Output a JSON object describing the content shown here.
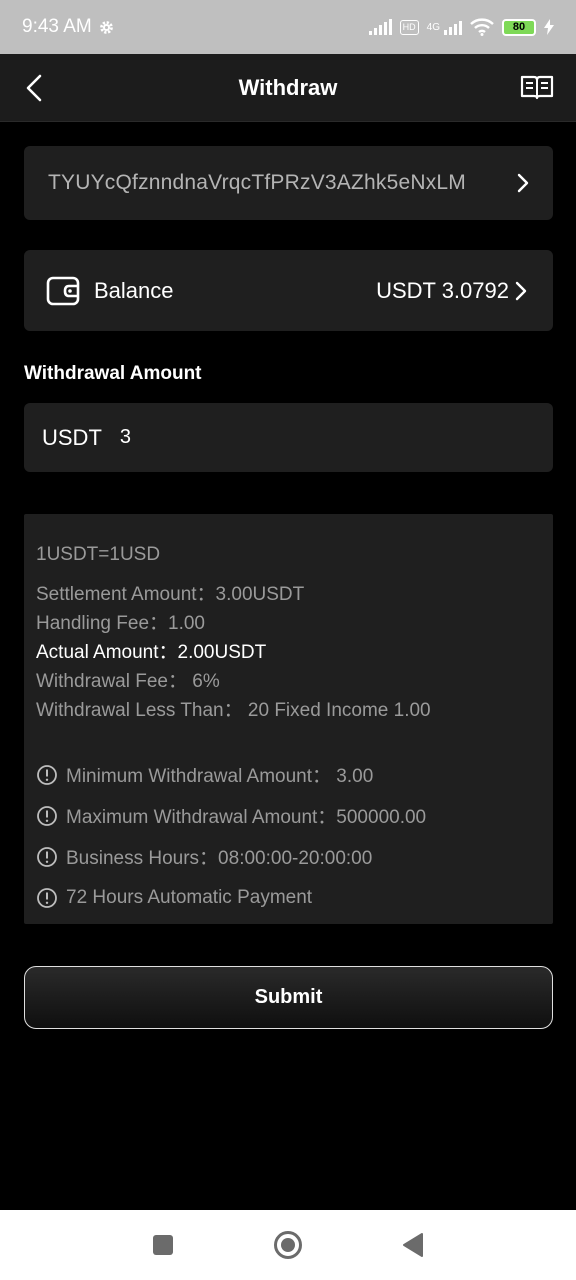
{
  "status_bar": {
    "time": "9:43 AM",
    "network_label": "4G",
    "volte_label": "HD",
    "battery": "80"
  },
  "header": {
    "title": "Withdraw"
  },
  "address": {
    "value": "TYUYcQfznndnaVrqcTfPRzV3AZhk5eNxLM"
  },
  "balance": {
    "label": "Balance",
    "value": "USDT 3.0792"
  },
  "withdrawal": {
    "section_label": "Withdrawal Amount",
    "unit": "USDT",
    "amount": "3"
  },
  "info": {
    "rate": "1USDT=1USD",
    "settlement": "Settlement Amount：3.00USDT",
    "handling_fee": "Handling Fee：1.00",
    "actual_amount": "Actual Amount：2.00USDT",
    "withdrawal_fee": "Withdrawal Fee： 6%",
    "less_than": "Withdrawal Less Than： 20 Fixed Income 1.00",
    "notes": [
      "Minimum Withdrawal Amount： 3.00",
      "Maximum Withdrawal Amount：500000.00",
      "Business Hours：08:00:00-20:00:00",
      "72 Hours Automatic Payment"
    ]
  },
  "submit": {
    "label": "Submit"
  },
  "colors": {
    "background": "#000000",
    "card": "#1f1f1f",
    "muted_text": "#9a9a9a",
    "status_bar": "#bfbfbf",
    "battery_fill": "#7ed957"
  },
  "icons": [
    "settings-gear-icon",
    "signal-icon",
    "wifi-icon",
    "battery-icon",
    "back-arrow-icon",
    "guide-book-icon",
    "chevron-right-icon",
    "wallet-icon",
    "info-circle-icon",
    "nav-square-icon",
    "nav-circle-icon",
    "nav-triangle-icon"
  ]
}
